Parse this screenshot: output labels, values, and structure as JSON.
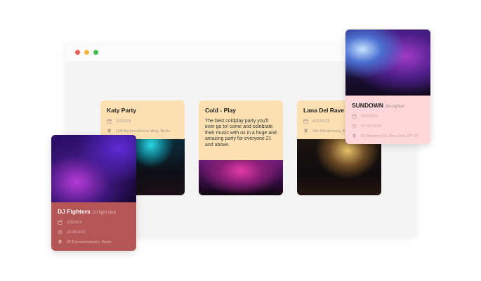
{
  "window": {
    "traffic_lights": [
      "#ef5b55",
      "#f5b53a",
      "#3ec04a"
    ]
  },
  "events": {
    "katy": {
      "title": "Katy Party",
      "date": "2/7/2023",
      "address": "10A Aschersleberer Weg, Berlin"
    },
    "cold": {
      "title": "Cold - Play",
      "description": "The best coldplay party you'll ever go to! come and celebrate their music with us in a huge and amazing party for everyone 21 and above."
    },
    "lana": {
      "title": "Lana Del Rave",
      "date": "9/12/2023",
      "address": "Silo Wardenweg, B"
    },
    "dj": {
      "title": "DJ Fighters",
      "subtitle": "DJ fight club",
      "date": "3/3/2024",
      "time": "23:00-9:00",
      "address": "22 Dornschestraße, Berlin"
    },
    "sundown": {
      "title": "SUNDOWN",
      "subtitle": "All-nighter",
      "date": "29/2/2023",
      "time": "22:00-10:00",
      "address": "83 Bayberry Dr. New York, NY 25"
    }
  },
  "icons": {
    "date": "calendar-icon",
    "time": "clock-icon",
    "address": "location-pin-icon"
  }
}
